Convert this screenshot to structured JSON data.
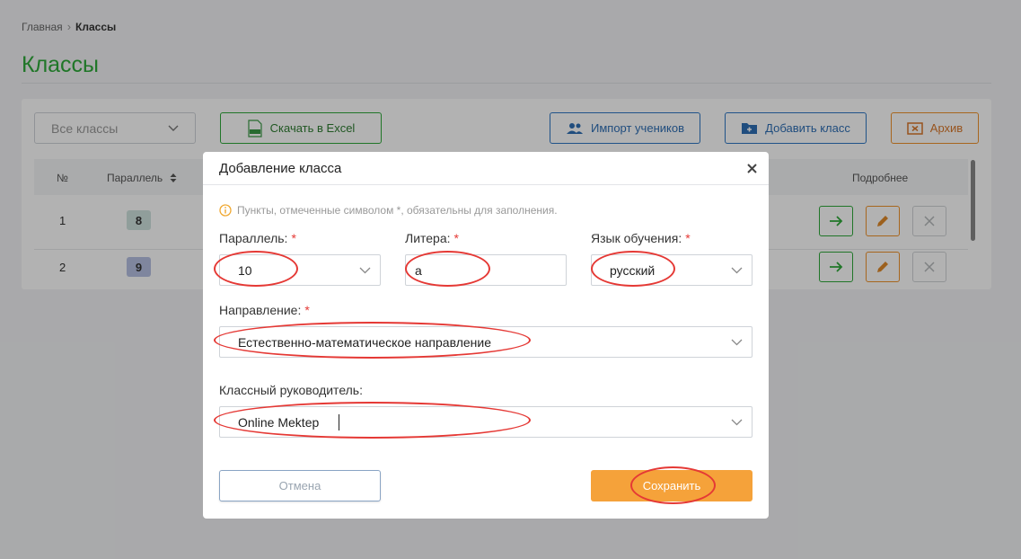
{
  "breadcrumb": {
    "home": "Главная",
    "current": "Классы"
  },
  "page": {
    "title": "Классы",
    "filter_value": "Все классы",
    "excel_button": "Скачать в Excel",
    "import_button": "Импорт учеников",
    "add_button": "Добавить класс",
    "archive_button": "Архив"
  },
  "table": {
    "headers": {
      "num": "№",
      "parallel": "Параллель",
      "details": "Подробнее"
    },
    "rows": [
      {
        "num": "1",
        "parallel": "8",
        "badge_color": "#cfe2de"
      },
      {
        "num": "2",
        "parallel": "9",
        "badge_color": "#b7c1e3"
      }
    ]
  },
  "modal": {
    "title": "Добавление класса",
    "notice": "Пункты, отмеченные символом *, обязательны для заполнения.",
    "required_mark": "*",
    "parallel": {
      "label": "Параллель:",
      "value": "10"
    },
    "letter": {
      "label": "Литера:",
      "value": "а"
    },
    "language": {
      "label": "Язык обучения:",
      "value": "русский"
    },
    "direction": {
      "label": "Направление:",
      "value": "Естественно-математическое направление"
    },
    "teacher": {
      "label": "Классный руководитель:",
      "value": "Online Mektep"
    },
    "cancel_button": "Отмена",
    "save_button": "Сохранить"
  },
  "colors": {
    "accent_green": "#2eaa3a",
    "accent_blue": "#2f78c4",
    "accent_orange": "#f5a23a",
    "highlight_red": "#e53935"
  }
}
